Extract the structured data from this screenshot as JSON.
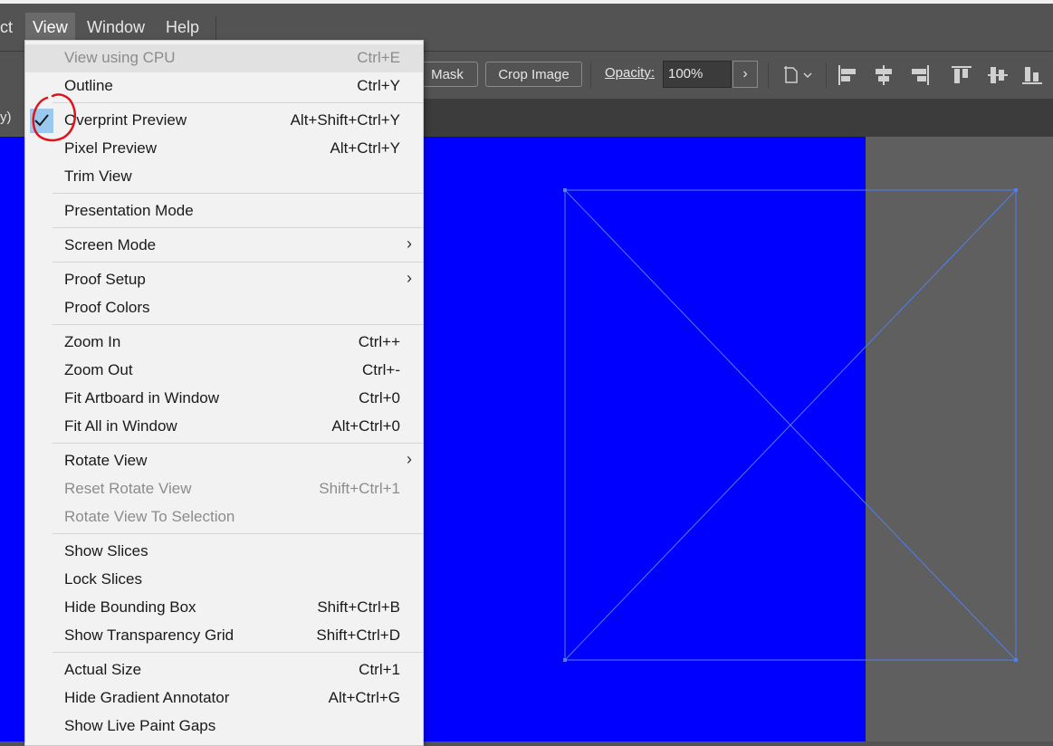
{
  "menubar": {
    "items": [
      "ct",
      "View",
      "Window",
      "Help"
    ]
  },
  "controlbar": {
    "mask_label": "Mask",
    "crop_label": "Crop Image",
    "opacity_label": "Opacity:",
    "opacity_value": "100%",
    "opacity_arrow": "›",
    "icons": [
      "artboard-options-icon",
      "align-left-icon",
      "align-horizontal-center-icon",
      "align-right-icon",
      "align-top-icon",
      "align-vertical-center-icon",
      "align-bottom-icon"
    ]
  },
  "tabstrip": {
    "fragment": "y)"
  },
  "colors": {
    "artboard": "#0000ff",
    "pasteboard": "#5f5f5f",
    "frame_stroke": "#4f7ff2",
    "menu_bg": "#f2f2f2",
    "annotation": "#e0141c"
  },
  "view_menu": {
    "items": [
      {
        "label": "View using CPU",
        "shortcut": "Ctrl+E"
      },
      {
        "label": "Outline",
        "shortcut": "Ctrl+Y"
      },
      {
        "label": "Overprint Preview",
        "shortcut": "Alt+Shift+Ctrl+Y"
      },
      {
        "label": "Pixel Preview",
        "shortcut": "Alt+Ctrl+Y"
      },
      {
        "label": "Trim View",
        "shortcut": ""
      },
      {
        "label": "Presentation Mode",
        "shortcut": ""
      },
      {
        "label": "Screen Mode",
        "shortcut": "",
        "submenu": "›"
      },
      {
        "label": "Proof Setup",
        "shortcut": "",
        "submenu": "›"
      },
      {
        "label": "Proof Colors",
        "shortcut": ""
      },
      {
        "label": "Zoom In",
        "shortcut": "Ctrl++"
      },
      {
        "label": "Zoom Out",
        "shortcut": "Ctrl+-"
      },
      {
        "label": "Fit Artboard in Window",
        "shortcut": "Ctrl+0"
      },
      {
        "label": "Fit All in Window",
        "shortcut": "Alt+Ctrl+0"
      },
      {
        "label": "Rotate View",
        "shortcut": "",
        "submenu": "›"
      },
      {
        "label": "Reset Rotate View",
        "shortcut": "Shift+Ctrl+1"
      },
      {
        "label": "Rotate View To Selection",
        "shortcut": ""
      },
      {
        "label": "Show Slices",
        "shortcut": ""
      },
      {
        "label": "Lock Slices",
        "shortcut": ""
      },
      {
        "label": "Hide Bounding Box",
        "shortcut": "Shift+Ctrl+B"
      },
      {
        "label": "Show Transparency Grid",
        "shortcut": "Shift+Ctrl+D"
      },
      {
        "label": "Actual Size",
        "shortcut": "Ctrl+1"
      },
      {
        "label": "Hide Gradient Annotator",
        "shortcut": "Alt+Ctrl+G"
      },
      {
        "label": "Show Live Paint Gaps",
        "shortcut": ""
      }
    ]
  }
}
